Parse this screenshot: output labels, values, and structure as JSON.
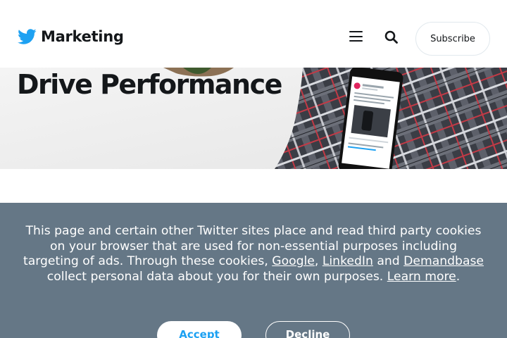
{
  "header": {
    "brand_name": "Marketing",
    "subscribe_label": "Subscribe",
    "brand_color": "#1da1f2"
  },
  "hero": {
    "title": "Drive Performance"
  },
  "cookie_banner": {
    "text_part1": "This page and certain other Twitter sites place and read third party cookies on your browser that are used for non-essential purposes including targeting of ads. Through these cookies,",
    "link_google": "Google",
    "sep_comma": ",",
    "link_linkedin": "LinkedIn",
    "text_and": "and",
    "link_demandbase": "Demandbase",
    "text_part2": "collect personal data about you for their own purposes.",
    "link_learn_more": "Learn more",
    "text_period": ".",
    "accept_label": "Accept",
    "decline_label": "Decline",
    "background_color": "#657786"
  }
}
